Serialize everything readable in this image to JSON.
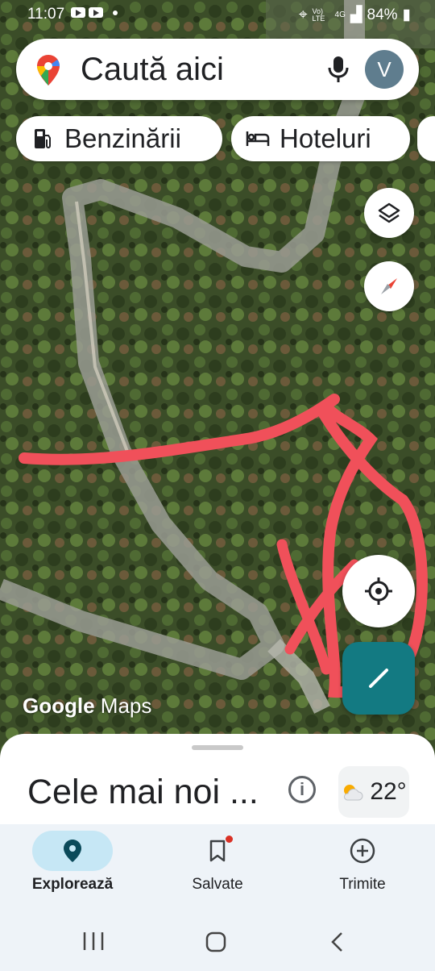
{
  "status_bar": {
    "time": "11:07",
    "carrier": "Vo) LTE",
    "network": "4G",
    "battery": "84%"
  },
  "search": {
    "placeholder": "Caută aici",
    "avatar_letter": "V"
  },
  "chips": [
    {
      "label": "Benzinării",
      "icon": "gas-station-icon"
    },
    {
      "label": "Hoteluri",
      "icon": "bed-icon"
    }
  ],
  "map": {
    "watermark_brand": "Google",
    "watermark_product": "Maps",
    "annotation_color": "#f0505a"
  },
  "sheet": {
    "title": "Cele mai noi ...",
    "info_glyph": "i",
    "weather_temp": "22°",
    "weather_icon": "partly-cloudy-icon"
  },
  "bottom_nav": [
    {
      "label": "Explorează",
      "icon": "location-pin-icon",
      "active": true
    },
    {
      "label": "Salvate",
      "icon": "bookmark-icon",
      "active": false,
      "badge": true
    },
    {
      "label": "Trimite",
      "icon": "add-circle-icon",
      "active": false
    }
  ],
  "colors": {
    "accent": "#137a82",
    "active_tab": "#c6e7f5"
  }
}
